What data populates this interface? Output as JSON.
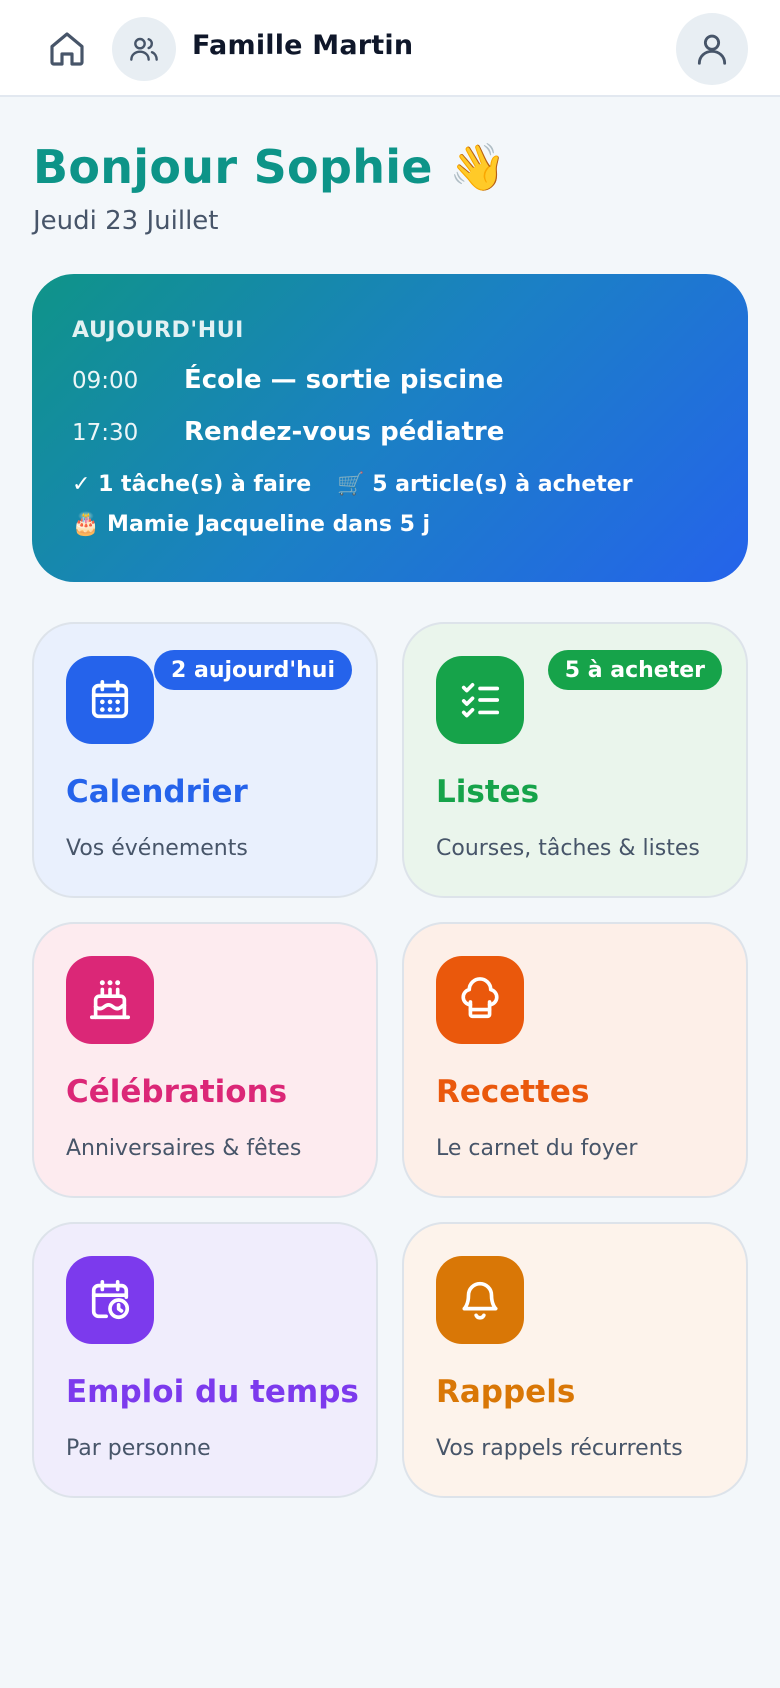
{
  "header": {
    "family_name": "Famille Martin"
  },
  "greeting": {
    "title": "Bonjour Sophie 👋",
    "date": "Jeudi 23 Juillet"
  },
  "today": {
    "label": "AUJOURD'HUI",
    "events": [
      {
        "time": "09:00",
        "title": "École — sortie piscine"
      },
      {
        "time": "17:30",
        "title": "Rendez-vous pédiatre"
      }
    ],
    "tasks": "✓ 1 tâche(s) à faire",
    "shopping": "🛒 5 article(s) à acheter",
    "birthday": "🎂 Mamie Jacqueline dans 5 j"
  },
  "tiles": [
    {
      "title": "Calendrier",
      "subtitle": "Vos événements",
      "badge": "2 aujourd'hui",
      "icon": "calendar-icon",
      "color": "#2563eb",
      "bg": "#e9f0fd"
    },
    {
      "title": "Listes",
      "subtitle": "Courses, tâches & listes",
      "badge": "5 à acheter",
      "icon": "checklist-icon",
      "color": "#16a34a",
      "bg": "#eaf5ec"
    },
    {
      "title": "Célébrations",
      "subtitle": "Anniversaires & fêtes",
      "icon": "cake-icon",
      "color": "#db2777",
      "bg": "#fdebef"
    },
    {
      "title": "Recettes",
      "subtitle": "Le carnet du foyer",
      "icon": "chef-hat-icon",
      "color": "#ea580c",
      "bg": "#fdefe8"
    },
    {
      "title": "Emploi du temps",
      "subtitle": "Par personne",
      "icon": "calendar-clock-icon",
      "color": "#7c3aed",
      "bg": "#f0edfc"
    },
    {
      "title": "Rappels",
      "subtitle": "Vos rappels récurrents",
      "icon": "bell-icon",
      "color": "#d97706",
      "bg": "#fdf3eb"
    }
  ]
}
